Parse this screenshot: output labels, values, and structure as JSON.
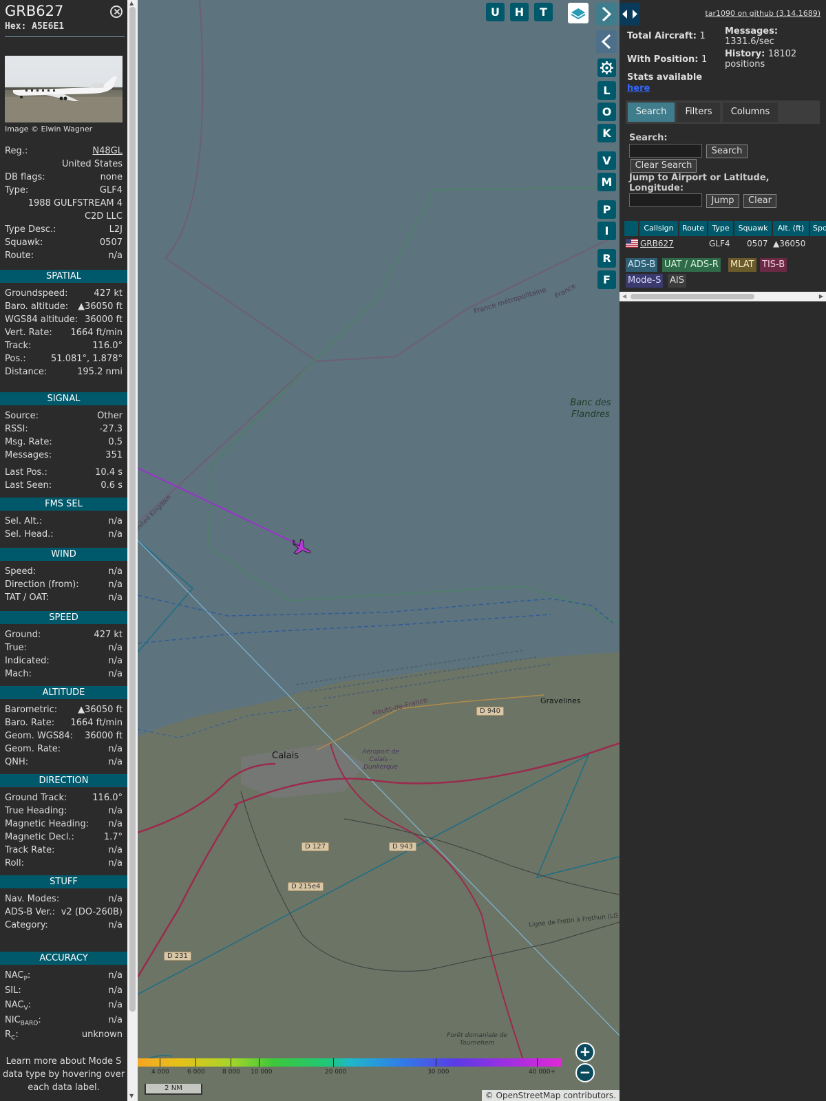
{
  "panel": {
    "callsign": "GRB627",
    "hex_label": "Hex:",
    "hex": "A5E6E1",
    "photo_credit": "Image © Elwin Wagner",
    "info": [
      {
        "k": "Reg.:",
        "v": "N48GL"
      },
      {
        "k": "",
        "v": "United States"
      },
      {
        "k": "DB flags:",
        "v": "none"
      },
      {
        "k": "Type:",
        "v": "GLF4"
      },
      {
        "k": "",
        "v": "1988 GULFSTREAM 4"
      },
      {
        "k": "",
        "v": "C2D LLC"
      },
      {
        "k": "Type Desc.:",
        "v": "L2J"
      },
      {
        "k": "Squawk:",
        "v": "0507"
      },
      {
        "k": "Route:",
        "v": "n/a"
      }
    ],
    "sections": [
      {
        "title": "SPATIAL",
        "rows": [
          {
            "k": "Groundspeed:",
            "v": "427 kt"
          },
          {
            "k": "Baro. altitude:",
            "v": "▲36050 ft"
          },
          {
            "k": "WGS84 altitude:",
            "v": "36000 ft"
          },
          {
            "k": "Vert. Rate:",
            "v": "1664 ft/min"
          },
          {
            "k": "Track:",
            "v": "116.0°"
          },
          {
            "k": "Pos.:",
            "v": "51.081°, 1.878°"
          },
          {
            "k": "Distance:",
            "v": "195.2 nmi"
          }
        ]
      },
      {
        "title": "SIGNAL",
        "rows": [
          {
            "k": "Source:",
            "v": "Other"
          },
          {
            "k": "RSSI:",
            "v": "-27.3"
          },
          {
            "k": "Msg. Rate:",
            "v": "0.5"
          },
          {
            "k": "Messages:",
            "v": "351"
          },
          {
            "k": "Last Pos.:",
            "v": "10.4 s"
          },
          {
            "k": "Last Seen:",
            "v": "0.6 s"
          }
        ]
      },
      {
        "title": "FMS SEL",
        "rows": [
          {
            "k": "Sel. Alt.:",
            "v": "n/a"
          },
          {
            "k": "Sel. Head.:",
            "v": "n/a"
          }
        ]
      },
      {
        "title": "WIND",
        "rows": [
          {
            "k": "Speed:",
            "v": "n/a"
          },
          {
            "k": "Direction (from):",
            "v": "n/a"
          },
          {
            "k": "TAT / OAT:",
            "v": "n/a"
          }
        ]
      },
      {
        "title": "SPEED",
        "rows": [
          {
            "k": "Ground:",
            "v": "427 kt"
          },
          {
            "k": "True:",
            "v": "n/a"
          },
          {
            "k": "Indicated:",
            "v": "n/a"
          },
          {
            "k": "Mach:",
            "v": "n/a"
          }
        ]
      },
      {
        "title": "ALTITUDE",
        "rows": [
          {
            "k": "Barometric:",
            "v": "▲36050 ft"
          },
          {
            "k": "Baro. Rate:",
            "v": "1664 ft/min"
          },
          {
            "k": "Geom. WGS84:",
            "v": "36000 ft"
          },
          {
            "k": "Geom. Rate:",
            "v": "n/a"
          },
          {
            "k": "QNH:",
            "v": "n/a"
          }
        ]
      },
      {
        "title": "DIRECTION",
        "rows": [
          {
            "k": "Ground Track:",
            "v": "116.0°"
          },
          {
            "k": "True Heading:",
            "v": "n/a"
          },
          {
            "k": "Magnetic Heading:",
            "v": "n/a"
          },
          {
            "k": "Magnetic Decl.:",
            "v": "1.7°"
          },
          {
            "k": "Track Rate:",
            "v": "n/a"
          },
          {
            "k": "Roll:",
            "v": "n/a"
          }
        ]
      },
      {
        "title": "STUFF",
        "rows": [
          {
            "k": "Nav. Modes:",
            "v": "n/a"
          },
          {
            "k": "ADS-B Ver.:",
            "v": "v2 (DO-260B)"
          },
          {
            "k": "Category:",
            "v": "n/a"
          }
        ]
      },
      {
        "title": "ACCURACY",
        "rows": [
          {
            "k": "NACp:",
            "v": "n/a"
          },
          {
            "k": "SIL:",
            "v": "n/a"
          },
          {
            "k": "NACv:",
            "v": "n/a"
          },
          {
            "k": "NICbaro:",
            "v": "n/a"
          },
          {
            "k": "Rc:",
            "v": "unknown"
          }
        ]
      }
    ],
    "footnote": "Learn more about Mode S data type by hovering over each data label."
  },
  "map": {
    "buttons_top": [
      "U",
      "H",
      "T"
    ],
    "side_buttons": [
      "L",
      "O",
      "K",
      "V",
      "M",
      "P",
      "I",
      "R",
      "F"
    ],
    "place_labels": {
      "banc": "Banc des Flandres",
      "france_metro": "France métropolitaine",
      "france": "France",
      "uk": "United Kingdom",
      "hauts": "Hauts-de-France",
      "calais": "Calais",
      "gravelines": "Gravelines",
      "aeroport": "Aéroport de Calais - Dunkerque",
      "foret": "Forêt domaniale de Tournehem",
      "ligne": "Ligne de Fretin à Frethun (LG"
    },
    "roads": [
      "D 940",
      "D 943",
      "D 127",
      "D 215e4",
      "D 231"
    ],
    "altitude_ticks": [
      "4 000",
      "6 000",
      "8 000",
      "10 000",
      "20 000",
      "30 000",
      "40 000+"
    ],
    "scale": "2 NM",
    "attribution_prefix": "© OpenStreetMap",
    "attribution_suffix": "contributors.",
    "colors": {
      "water": "#5d737d",
      "track": "#9933cc",
      "aircraft": "#b43cd4"
    }
  },
  "right": {
    "github": "tar1090 on github (3.14.1689)",
    "total_aircraft_label": "Total Aircraft:",
    "total_aircraft": "1",
    "with_position_label": "With Position:",
    "with_position": "1",
    "stats_label": "Stats available",
    "stats_link": "here",
    "messages_label": "Messages:",
    "messages_rate": "1331.6/sec",
    "history_label": "History:",
    "history_value": "18102",
    "history_unit": "positions",
    "tabs": [
      "Search",
      "Filters",
      "Columns"
    ],
    "search_label": "Search:",
    "search_button": "Search",
    "clear_search": "Clear Search",
    "jump_label": "Jump to Airport or Latitude, Longitude:",
    "jump_button": "Jump",
    "clear_button": "Clear",
    "table_headers": [
      "Callsign",
      "Route",
      "Type",
      "Squawk",
      "Alt. (ft)",
      "Spd"
    ],
    "table_row": {
      "callsign": "GRB627",
      "route": "",
      "type": "GLF4",
      "squawk": "0507",
      "alt": "▲36050"
    },
    "badges": [
      {
        "label": "ADS-B",
        "bg": "#2e5f74",
        "color": "#cfe8f2"
      },
      {
        "label": "UAT / ADS-R",
        "bg": "#2f6b48",
        "color": "#d6f2dd"
      },
      {
        "label": "MLAT",
        "bg": "#6b5a2a",
        "color": "#f3e6c2"
      },
      {
        "label": "TIS-B",
        "bg": "#6b2a44",
        "color": "#f5cddd"
      },
      {
        "label": "Mode-S",
        "bg": "#3a3a6e",
        "color": "#dcdcff"
      },
      {
        "label": "AIS",
        "bg": "#3c3c3c",
        "color": "#dddddd"
      }
    ]
  }
}
